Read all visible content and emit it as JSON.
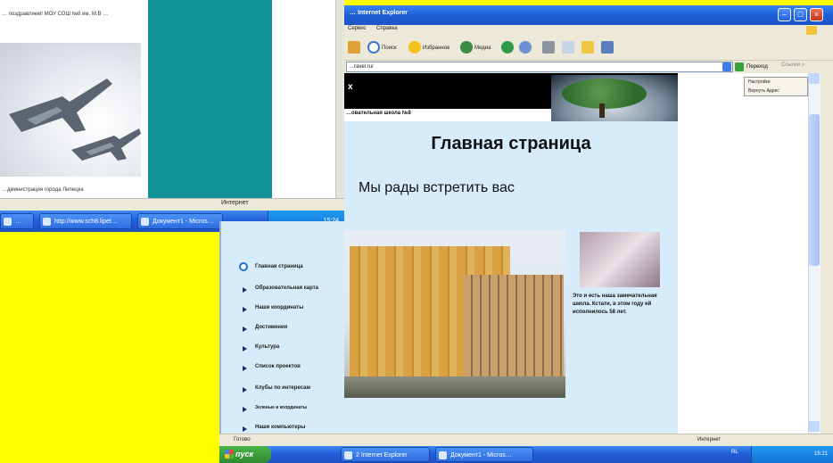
{
  "left_page": {
    "top_text": "… поздравляем! МОУ СОШ №8 им. М.В …",
    "bottom_text": "…дминистрация города Липецка"
  },
  "status_mid": {
    "zone": "Интернет"
  },
  "taskbar_left": {
    "buttons": [
      "… ",
      "http://www.sch8.lipet…",
      "Документ1 - Micros…"
    ],
    "clock": "15:24"
  },
  "menu": {
    "items": [
      "Главная страница",
      "Образовательная карта",
      "Наши координаты",
      "Достижения",
      "Культура",
      "Список проектов",
      "Клубы по интересам",
      "Зеленые и координаты",
      "Наши компьютеры"
    ]
  },
  "ie": {
    "title": "… Internet Explorer",
    "menus": [
      "Сервис",
      "Справка"
    ],
    "toolbar": {
      "search": "Поиск",
      "favorites": "Избранное",
      "media": "Медиа"
    },
    "address": "…ravel.ru/",
    "go_label": "Переход",
    "links_label": "Ссылки »",
    "status": "Готово",
    "zone": "Интернет",
    "popup": [
      "Настройки",
      "Вернуть Адрес"
    ]
  },
  "page": {
    "header_mark": "x",
    "school_name": "…овательная школа №8",
    "heading": "Главная страница",
    "welcome": "Мы рады встретить вас",
    "caption": "Это и есть наша замечательная школа. Кстати, в этом году ей исполнилось 58 лет."
  },
  "taskbar": {
    "start": "пуск",
    "buttons": [
      "2 Internet Explorer",
      "Документ1 - Micros…"
    ],
    "tray_lang": "RL",
    "clock": "15:21"
  },
  "colors": {
    "teal": "#129297",
    "yellow": "#ffff00",
    "page_bg": "#d7ecfa",
    "xp_blue": "#245edb"
  }
}
